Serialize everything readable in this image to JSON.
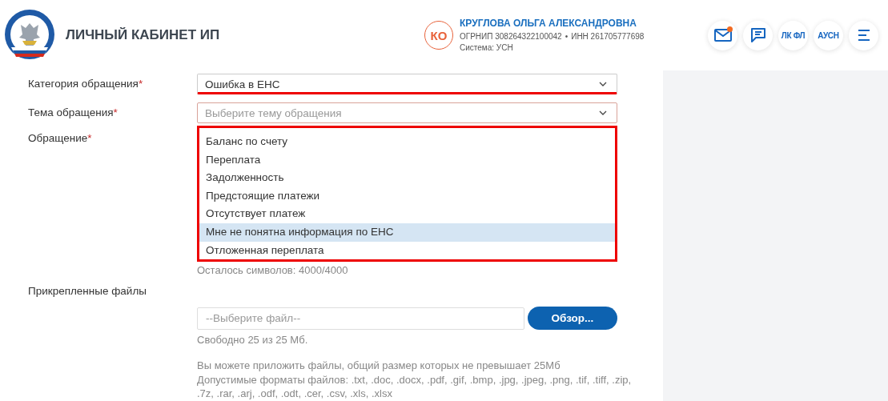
{
  "header": {
    "title": "ЛИЧНЫЙ КАБИНЕТ ИП",
    "user": {
      "initials": "КО",
      "name": "КРУГЛОВА ОЛЬГА АЛЕКСАНДРОВНА",
      "ogrnip": "ОГРНИП 308264322100042",
      "separator": "•",
      "inn": "ИНН 261705777698",
      "system": "Система: УСН"
    },
    "actions": [
      {
        "kind": "mail",
        "notification": true
      },
      {
        "kind": "chat",
        "notification": false
      },
      {
        "kind": "text",
        "label": "ЛК ФЛ"
      },
      {
        "kind": "text",
        "label": "АУСН"
      },
      {
        "kind": "menu"
      }
    ]
  },
  "form": {
    "category": {
      "label": "Категория обращения",
      "required_mark": "*",
      "value": "Ошибка в ЕНС"
    },
    "topic": {
      "label": "Тема обращения",
      "required_mark": "*",
      "placeholder": "Выберите тему обращения",
      "expanded": true,
      "options": [
        {
          "label": "Баланс по счету",
          "selected": false
        },
        {
          "label": "Переплата",
          "selected": false
        },
        {
          "label": "Задолженность",
          "selected": false
        },
        {
          "label": "Предстоящие платежи",
          "selected": false
        },
        {
          "label": "Отсутствует платеж",
          "selected": false
        },
        {
          "label": "Мне не понятна информация по ЕНС",
          "selected": true
        },
        {
          "label": "Отложенная переплата",
          "selected": false
        }
      ]
    },
    "message": {
      "label": "Обращение",
      "required_mark": "*",
      "counter": "Осталось символов: 4000/4000"
    },
    "files": {
      "label": "Прикрепленные файлы",
      "placeholder": "--Выберите файл--",
      "button": "Обзор...",
      "free": "Свободно 25 из 25 Мб.",
      "hint": [
        "Вы можете приложить файлы, общий размер которых не превышает 25Мб",
        "Допустимые форматы файлов: .txt, .doc, .docx, .pdf, .gif, .bmp, .jpg, .jpeg, .png, .tif, .tiff, .zip, .7z, .rar, .arj, .odf, .odt, .cer, .csv, .xls, .xlsx"
      ]
    }
  }
}
